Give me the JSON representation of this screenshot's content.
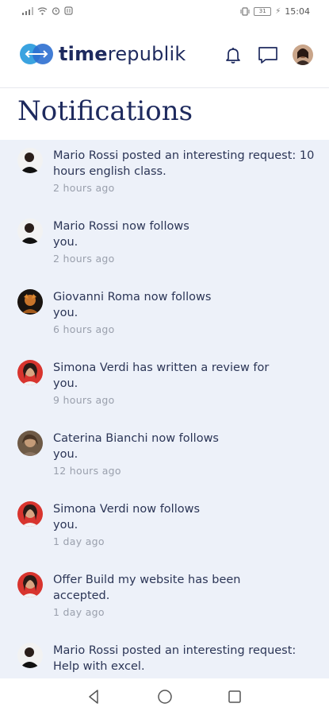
{
  "status_bar": {
    "time": "15:04",
    "battery": "31"
  },
  "header": {
    "brand_bold": "time",
    "brand_light": "republik"
  },
  "page_title": "Notifications",
  "notifications": [
    {
      "text": "Mario Rossi posted an interesting request: 10 hours english class.",
      "time": "2 hours ago",
      "avatar": "avatar-dark-man"
    },
    {
      "text": "Mario Rossi now follows you.",
      "time": "2 hours ago",
      "avatar": "avatar-dark-man"
    },
    {
      "text": "Giovanni Roma now follows you.",
      "time": "6 hours ago",
      "avatar": "avatar-orange"
    },
    {
      "text": "Simona Verdi has written a review for you.",
      "time": "9 hours ago",
      "avatar": "avatar-woman"
    },
    {
      "text": "Caterina Bianchi now follows you.",
      "time": "12 hours ago",
      "avatar": "avatar-brown"
    },
    {
      "text": "Simona Verdi now follows you.",
      "time": "1 day ago",
      "avatar": "avatar-woman"
    },
    {
      "text": "Offer Build my website has been accepted.",
      "time": "1 day ago",
      "avatar": "avatar-woman"
    },
    {
      "text": "Mario Rossi posted an interesting request: Help with excel.",
      "time": "",
      "avatar": "avatar-dark-man"
    }
  ],
  "colors": {
    "brand": "#1e2a5e",
    "accent": "#3aa3e0",
    "list_bg": "#edf1f9"
  }
}
